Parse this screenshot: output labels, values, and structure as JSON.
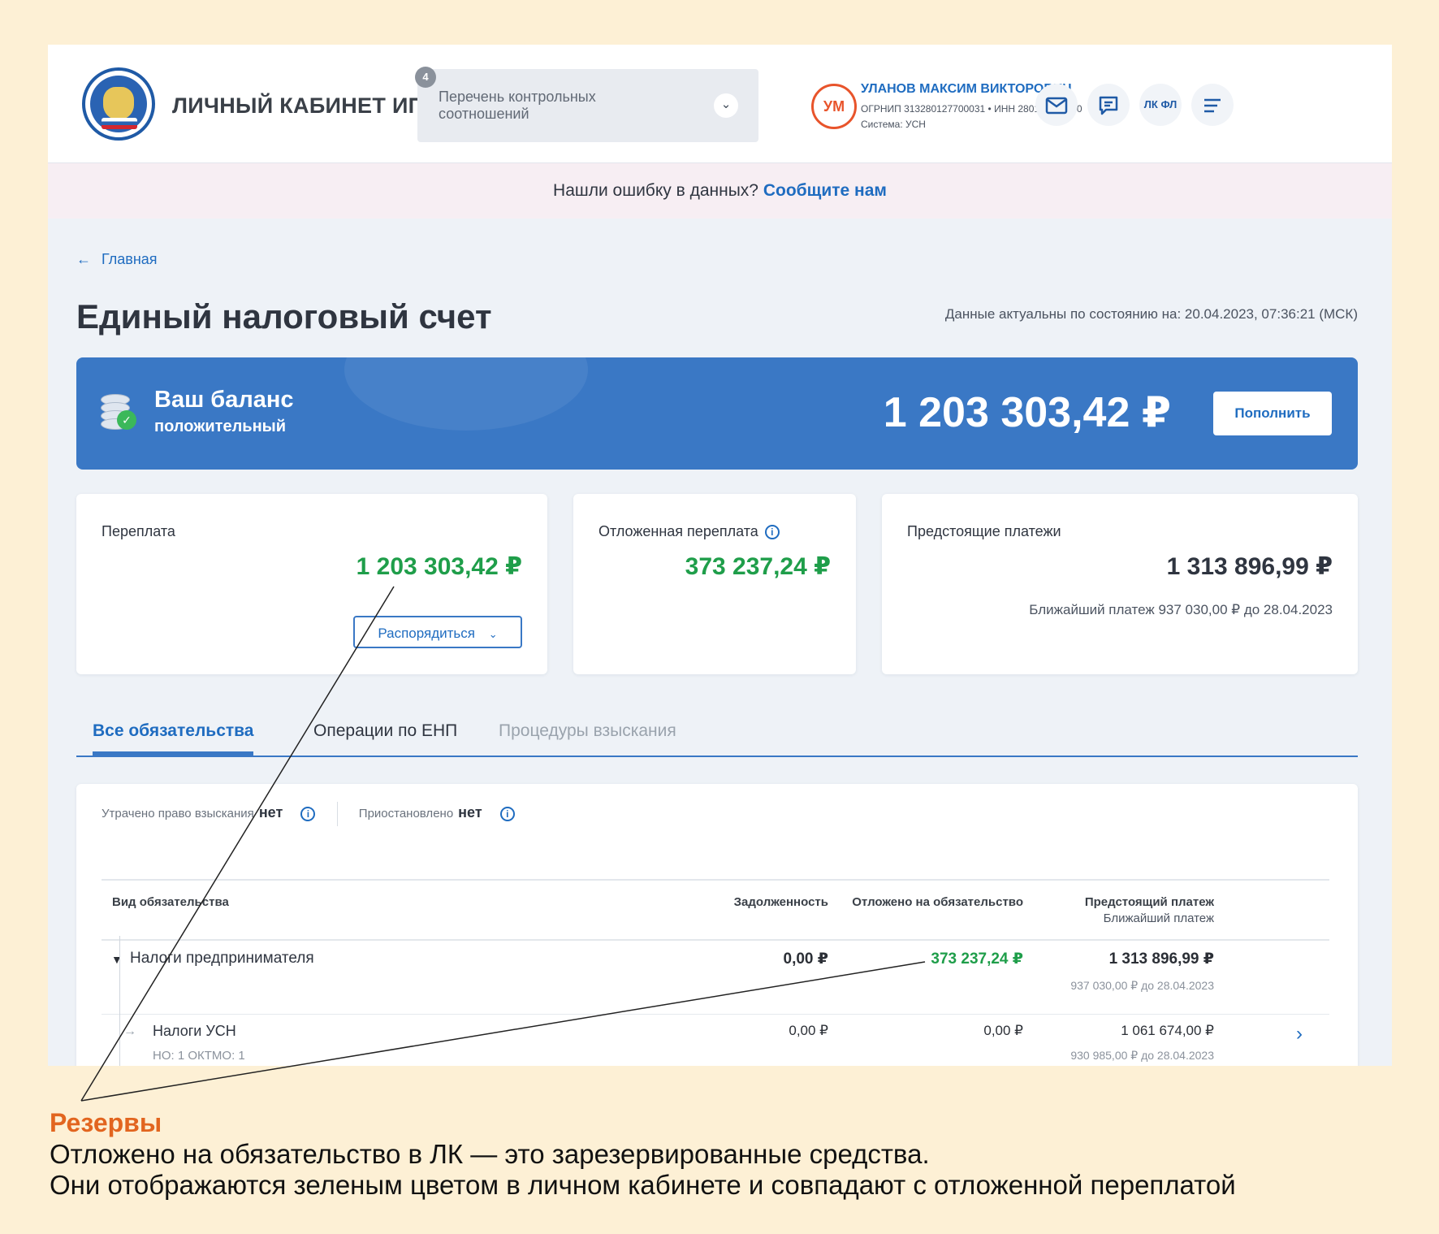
{
  "header": {
    "brand": "ЛИЧНЫЙ КАБИНЕТ ИП",
    "ratios_badge": "4",
    "ratios_select": "Перечень контрольных соотношений",
    "avatar": "УМ",
    "user_name": "УЛАНОВ МАКСИМ ВИКТОРОВИЧ",
    "user_ids": "ОГРНИП 313280127700031 • ИНН 280116608490",
    "user_system": "Система: УСН",
    "lk_fl": "ЛК ФЛ"
  },
  "banner": {
    "text": "Нашли ошибку в данных?",
    "link": "Сообщите нам"
  },
  "breadcrumb": {
    "arrow": "←",
    "label": "Главная"
  },
  "page": {
    "title": "Единый налоговый счет",
    "actual": "Данные актуальны по состоянию на: 20.04.2023, 07:36:21 (МСК)"
  },
  "balance": {
    "title": "Ваш баланс",
    "status": "положительный",
    "amount": "1 203 303,42 ₽",
    "refill": "Пополнить"
  },
  "cards": {
    "overpayment": {
      "label": "Переплата",
      "amount": "1 203 303,42 ₽",
      "action": "Распорядиться"
    },
    "deferred": {
      "label": "Отложенная переплата",
      "amount": "373 237,24 ₽"
    },
    "upcoming": {
      "label": "Предстоящие платежи",
      "amount": "1 313 896,99 ₽",
      "next": "Ближайший платеж 937 030,00 ₽ до 28.04.2023"
    }
  },
  "tabs": [
    "Все обязательства",
    "Операции по ЕНП",
    "Процедуры взыскания"
  ],
  "flags": {
    "lost_label": "Утрачено право взыскания",
    "lost_value": "нет",
    "suspended_label": "Приостановлено",
    "suspended_value": "нет"
  },
  "table": {
    "columns": [
      "Вид обязательства",
      "Задолженность",
      "Отложено на обязательство",
      "Предстоящий платеж",
      "Ближайший платеж"
    ],
    "rows": [
      {
        "name": "Налоги предпринимателя",
        "debt": "0,00 ₽",
        "reserved": "373 237,24 ₽",
        "upcoming": "1 313 896,99 ₽",
        "nearest": "937 030,00 ₽ до 28.04.2023"
      },
      {
        "name": "Налоги УСН",
        "meta": "НО: 1 ОКТМО: 1",
        "debt": "0,00 ₽",
        "reserved": "0,00 ₽",
        "upcoming": "1 061 674,00 ₽",
        "nearest": "930 985,00 ₽ до 28.04.2023"
      }
    ]
  },
  "note": {
    "heading": "Резервы",
    "line1": "Отложено на обязательство в ЛК — это зарезервированные средства.",
    "line2": "Они отображаются зеленым цветом в личном кабинете и совпадают с отложенной переплатой"
  },
  "colors": {
    "page_bg": "#fdf0d5",
    "accent_blue": "#3a78c5",
    "link_blue": "#1f6cc0",
    "green": "#1f9e4a",
    "note_orange": "#e2651f"
  }
}
